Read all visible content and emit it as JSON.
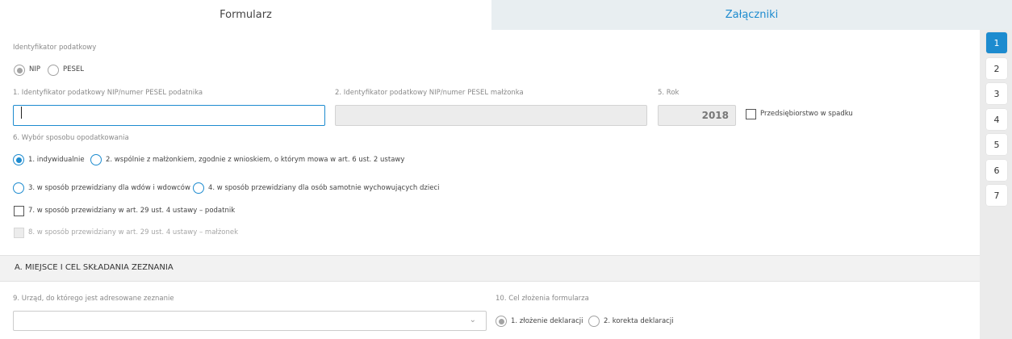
{
  "tabs": {
    "form": "Formularz",
    "attachments": "Załączniki"
  },
  "taxid": {
    "heading": "Identyfikator podatkowy",
    "nip_label": "NIP",
    "pesel_label": "PESEL",
    "selected": "NIP"
  },
  "fields": {
    "field1_label": "1. Identyfikator podatkowy NIP/numer PESEL podatnika",
    "field1_value": "",
    "field2_label": "2. Identyfikator podatkowy NIP/numer PESEL małżonka",
    "field2_value": "",
    "field5_label": "5. Rok",
    "field5_value": "2018",
    "estate_label": "Przedsiębiorstwo w spadku"
  },
  "taxation": {
    "heading": "6. Wybór sposobu opodatkowania",
    "opt1": "1. indywidualnie",
    "opt2": "2. wspólnie z małżonkiem, zgodnie z wnioskiem, o którym mowa w art. 6 ust. 2 ustawy",
    "opt3": "3. w sposób przewidziany dla wdów i wdowców",
    "opt4": "4. w sposób przewidziany dla osób samotnie wychowujących dzieci",
    "opt7": "7. w sposób przewidziany w art. 29 ust. 4 ustawy – podatnik",
    "opt8": "8. w sposób przewidziany w art. 29 ust. 4 ustawy – małżonek",
    "selected": "1. indywidualnie"
  },
  "sectionA": {
    "title": "A. MIEJSCE I CEL SKŁADANIA ZEZNANIA",
    "office_label": "9. Urząd, do którego jest adresowane zeznanie",
    "office_value": "",
    "purpose_label": "10. Cel złożenia formularza",
    "purpose_opt1": "1. złożenie deklaracji",
    "purpose_opt2": "2. korekta deklaracji",
    "purpose_selected": "1. złożenie deklaracji"
  },
  "steps": [
    "1",
    "2",
    "3",
    "4",
    "5",
    "6",
    "7"
  ],
  "active_step": "1",
  "colors": {
    "accent": "#1d8bcf",
    "tab_inactive_bg": "#e8eef1",
    "section_bg": "#f2f2f2"
  }
}
